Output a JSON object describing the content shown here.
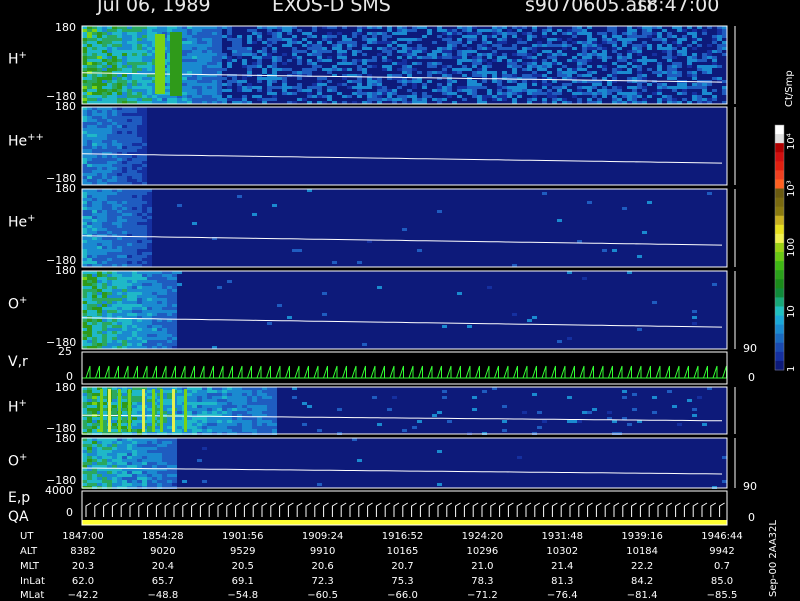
{
  "header": {
    "date": "Jul 06, 1989",
    "instrument": "EXOS-D SMS",
    "filename": "s9070605.asr",
    "time": "18:47:00"
  },
  "panels": [
    {
      "id": "h_plus",
      "label_base": "H",
      "label_sup": "+",
      "ymax": "180",
      "ymin": "−180"
    },
    {
      "id": "he_pp",
      "label_base": "He",
      "label_sup": "++",
      "ymax": "180",
      "ymin": "−180"
    },
    {
      "id": "he_plus",
      "label_base": "He",
      "label_sup": "+",
      "ymax": "180",
      "ymin": "−180"
    },
    {
      "id": "o_plus",
      "label_base": "O",
      "label_sup": "+",
      "ymax": "180",
      "ymin": "−180"
    }
  ],
  "vr_panel": {
    "label": "V,r",
    "ymax": "25",
    "ymid": "0",
    "right_top": "90",
    "right_bot": "0"
  },
  "lower_panels": [
    {
      "id": "h_plus_2",
      "label_base": "H",
      "label_sup": "+",
      "ymax": "180",
      "ymin": "−180"
    },
    {
      "id": "o_plus_2",
      "label_base": "O",
      "label_sup": "+",
      "ymax": "180",
      "ymin": "−180",
      "right_top": "90"
    }
  ],
  "ep_panel": {
    "label1": "E,p",
    "label2": "QA",
    "ymax": "4000",
    "ymid": "0",
    "right_bot": "0"
  },
  "colorbar": {
    "unit": "Ct/Smp",
    "ticks": [
      "10⁴",
      "10³",
      "100",
      "10",
      "1"
    ]
  },
  "ephemeris": {
    "row_labels": [
      "UT",
      "ALT",
      "MLT",
      "InLat",
      "MLat"
    ],
    "columns": [
      {
        "UT": "1847:00",
        "ALT": "8382",
        "MLT": "20.3",
        "InLat": "62.0",
        "MLat": "−42.2"
      },
      {
        "UT": "1854:28",
        "ALT": "9020",
        "MLT": "20.4",
        "InLat": "65.7",
        "MLat": "−48.8"
      },
      {
        "UT": "1901:56",
        "ALT": "9529",
        "MLT": "20.5",
        "InLat": "69.1",
        "MLat": "−54.8"
      },
      {
        "UT": "1909:24",
        "ALT": "9910",
        "MLT": "20.6",
        "InLat": "72.3",
        "MLat": "−60.5"
      },
      {
        "UT": "1916:52",
        "ALT": "10165",
        "MLT": "20.7",
        "InLat": "75.3",
        "MLat": "−66.0"
      },
      {
        "UT": "1924:20",
        "ALT": "10296",
        "MLT": "21.0",
        "InLat": "78.3",
        "MLat": "−71.2"
      },
      {
        "UT": "1931:48",
        "ALT": "10302",
        "MLT": "21.4",
        "InLat": "81.3",
        "MLat": "−76.4"
      },
      {
        "UT": "1939:16",
        "ALT": "10184",
        "MLT": "22.2",
        "InLat": "84.2",
        "MLat": "−81.4"
      },
      {
        "UT": "1946:44",
        "ALT": "9942",
        "MLT": "0.7",
        "InLat": "85.0",
        "MLat": "−85.5"
      }
    ]
  },
  "footer_version": "Sep-00  2AA32L",
  "chart_data": {
    "type": "heatmap",
    "title": "Jul 06, 1989   EXOS-D SMS",
    "x": [
      "1847:00",
      "1854:28",
      "1901:56",
      "1909:24",
      "1916:52",
      "1924:20",
      "1931:48",
      "1939:16",
      "1946:44"
    ],
    "ylim": [
      -180,
      180
    ],
    "series": [
      {
        "name": "H+"
      },
      {
        "name": "He++"
      },
      {
        "name": "He+"
      },
      {
        "name": "O+"
      },
      {
        "name": "V,r"
      },
      {
        "name": "H+"
      },
      {
        "name": "O+"
      },
      {
        "name": "E,p"
      }
    ],
    "color_scale": {
      "label": "Ct/Smp",
      "scale": "log",
      "range": [
        1,
        10000
      ]
    },
    "colors": {
      "background": "#000000",
      "low": "#0d1a7a",
      "mid": "#1aa8d8",
      "high": "#3fcf1f",
      "peak": "#e02010",
      "trace": "#ffffff",
      "vr_trace": "#33ff33",
      "qa": "#ffff33"
    }
  }
}
